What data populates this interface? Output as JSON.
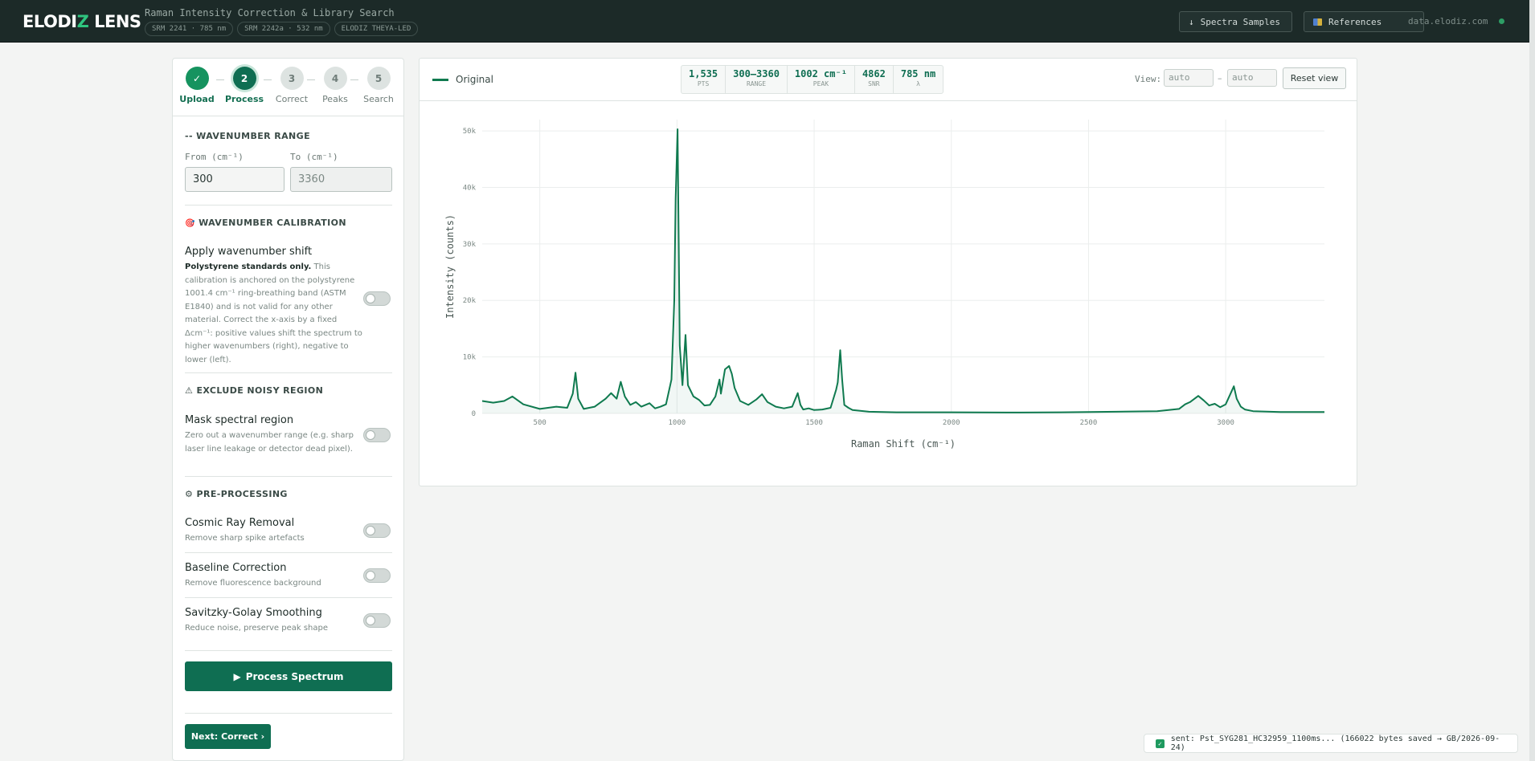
{
  "header": {
    "logo_main": "ELODI",
    "logo_z": "Z",
    "logo_tail": " LENS",
    "app_title": "Raman Intensity Correction & Library Search",
    "chips": [
      "SRM 2241 · 785 nm",
      "SRM 2242a · 532 nm",
      "ELODIZ THEYA-LED"
    ],
    "samples_button": "Spectra Samples",
    "samples_icon": "↓",
    "references_button": "References",
    "domain": "data.elodiz.com"
  },
  "stepper": [
    {
      "num": "✓",
      "label": "Upload",
      "state": "done"
    },
    {
      "num": "2",
      "label": "Process",
      "state": "active"
    },
    {
      "num": "3",
      "label": "Correct",
      "state": "todo"
    },
    {
      "num": "4",
      "label": "Peaks",
      "state": "todo"
    },
    {
      "num": "5",
      "label": "Search",
      "state": "todo"
    }
  ],
  "range": {
    "title": "-- WAVENUMBER RANGE",
    "from_label": "From (cm⁻¹)",
    "to_label": "To (cm⁻¹)",
    "from_value": "300",
    "to_placeholder": "3360"
  },
  "calibration": {
    "title": "WAVENUMBER CALIBRATION",
    "icon": "🎯",
    "option_title": "Apply wavenumber shift",
    "desc_bold": "Polystyrene standards only.",
    "desc_rest": " This calibration is anchored on the polystyrene 1001.4 cm⁻¹ ring-breathing band (ASTM E1840) and is not valid for any other material. Correct the x-axis by a fixed Δcm⁻¹: positive values shift the spectrum to higher wavenumbers (right), negative to lower (left)."
  },
  "noisy": {
    "title": "⚠ EXCLUDE NOISY REGION",
    "option_title": "Mask spectral region",
    "desc": "Zero out a wavenumber range (e.g. sharp laser line leakage or detector dead pixel)."
  },
  "preprocessing": {
    "title": "⚙ PRE-PROCESSING",
    "options": [
      {
        "title": "Cosmic Ray Removal",
        "desc": "Remove sharp spike artefacts"
      },
      {
        "title": "Baseline Correction",
        "desc": "Remove fluorescence background"
      },
      {
        "title": "Savitzky-Golay Smoothing",
        "desc": "Reduce noise, preserve peak shape"
      }
    ]
  },
  "process_button": "Process Spectrum",
  "process_icon": "▶",
  "next_button": "Next: Correct ›",
  "chart_header": {
    "legend": "Original",
    "stats": [
      {
        "value": "1,535",
        "key": "PTS"
      },
      {
        "value": "300–3360",
        "key": "RANGE"
      },
      {
        "value": "1002 cm⁻¹",
        "key": "PEAK"
      },
      {
        "value": "4862",
        "key": "SNR"
      },
      {
        "value": "785 nm",
        "key": "λ"
      }
    ],
    "view_label": "View:",
    "view_from_placeholder": "auto",
    "view_to_placeholder": "auto",
    "view_dash": "–",
    "reset_button": "Reset view"
  },
  "chart_data": {
    "type": "line",
    "xlabel": "Raman Shift (cm⁻¹)",
    "ylabel": "Intensity (counts)",
    "xlim": [
      290,
      3360
    ],
    "ylim": [
      0,
      52000
    ],
    "x_ticks": [
      500,
      1000,
      1500,
      2000,
      2500,
      3000
    ],
    "y_ticks": [
      0,
      10000,
      20000,
      30000,
      40000,
      50000
    ],
    "y_tick_labels": [
      "0",
      "10k",
      "20k",
      "30k",
      "40k",
      "50k"
    ],
    "grid": true,
    "color": "#0f7a4f",
    "series": [
      {
        "name": "Original",
        "x": [
          290,
          330,
          370,
          400,
          440,
          500,
          560,
          600,
          620,
          630,
          640,
          660,
          700,
          740,
          760,
          780,
          795,
          810,
          830,
          850,
          870,
          900,
          920,
          940,
          960,
          980,
          990,
          995,
          1002,
          1010,
          1020,
          1025,
          1031,
          1040,
          1060,
          1080,
          1100,
          1120,
          1140,
          1155,
          1160,
          1175,
          1190,
          1200,
          1210,
          1230,
          1260,
          1290,
          1310,
          1330,
          1360,
          1390,
          1420,
          1440,
          1450,
          1460,
          1480,
          1500,
          1530,
          1560,
          1580,
          1586,
          1595,
          1602,
          1610,
          1625,
          1640,
          1700,
          1800,
          2000,
          2200,
          2400,
          2600,
          2750,
          2830,
          2852,
          2870,
          2900,
          2920,
          2940,
          2960,
          2980,
          3000,
          3030,
          3040,
          3055,
          3070,
          3100,
          3200,
          3360
        ],
        "y": [
          2200,
          1900,
          2200,
          3000,
          1600,
          800,
          1200,
          1000,
          3500,
          7200,
          2600,
          800,
          1200,
          2600,
          3600,
          2600,
          5600,
          3000,
          1500,
          2000,
          1200,
          1800,
          900,
          1200,
          1600,
          6000,
          20000,
          38000,
          50300,
          12000,
          5000,
          9000,
          13900,
          5000,
          3000,
          2400,
          1400,
          1500,
          3000,
          6000,
          3500,
          7800,
          8400,
          7000,
          4500,
          2200,
          1500,
          2500,
          3400,
          2000,
          1200,
          900,
          1200,
          3600,
          1500,
          700,
          900,
          600,
          700,
          1000,
          4200,
          5500,
          11200,
          6000,
          1500,
          1000,
          600,
          300,
          200,
          200,
          150,
          200,
          300,
          400,
          800,
          1600,
          2000,
          3100,
          2300,
          1400,
          1700,
          1100,
          1600,
          4800,
          2600,
          1200,
          700,
          400,
          250,
          250
        ]
      }
    ]
  },
  "toast": {
    "text": "sent: Pst_SYG281_HC32959_1100ms... (166022 bytes saved → GB/2026-09-24)",
    "icon": "✓"
  }
}
